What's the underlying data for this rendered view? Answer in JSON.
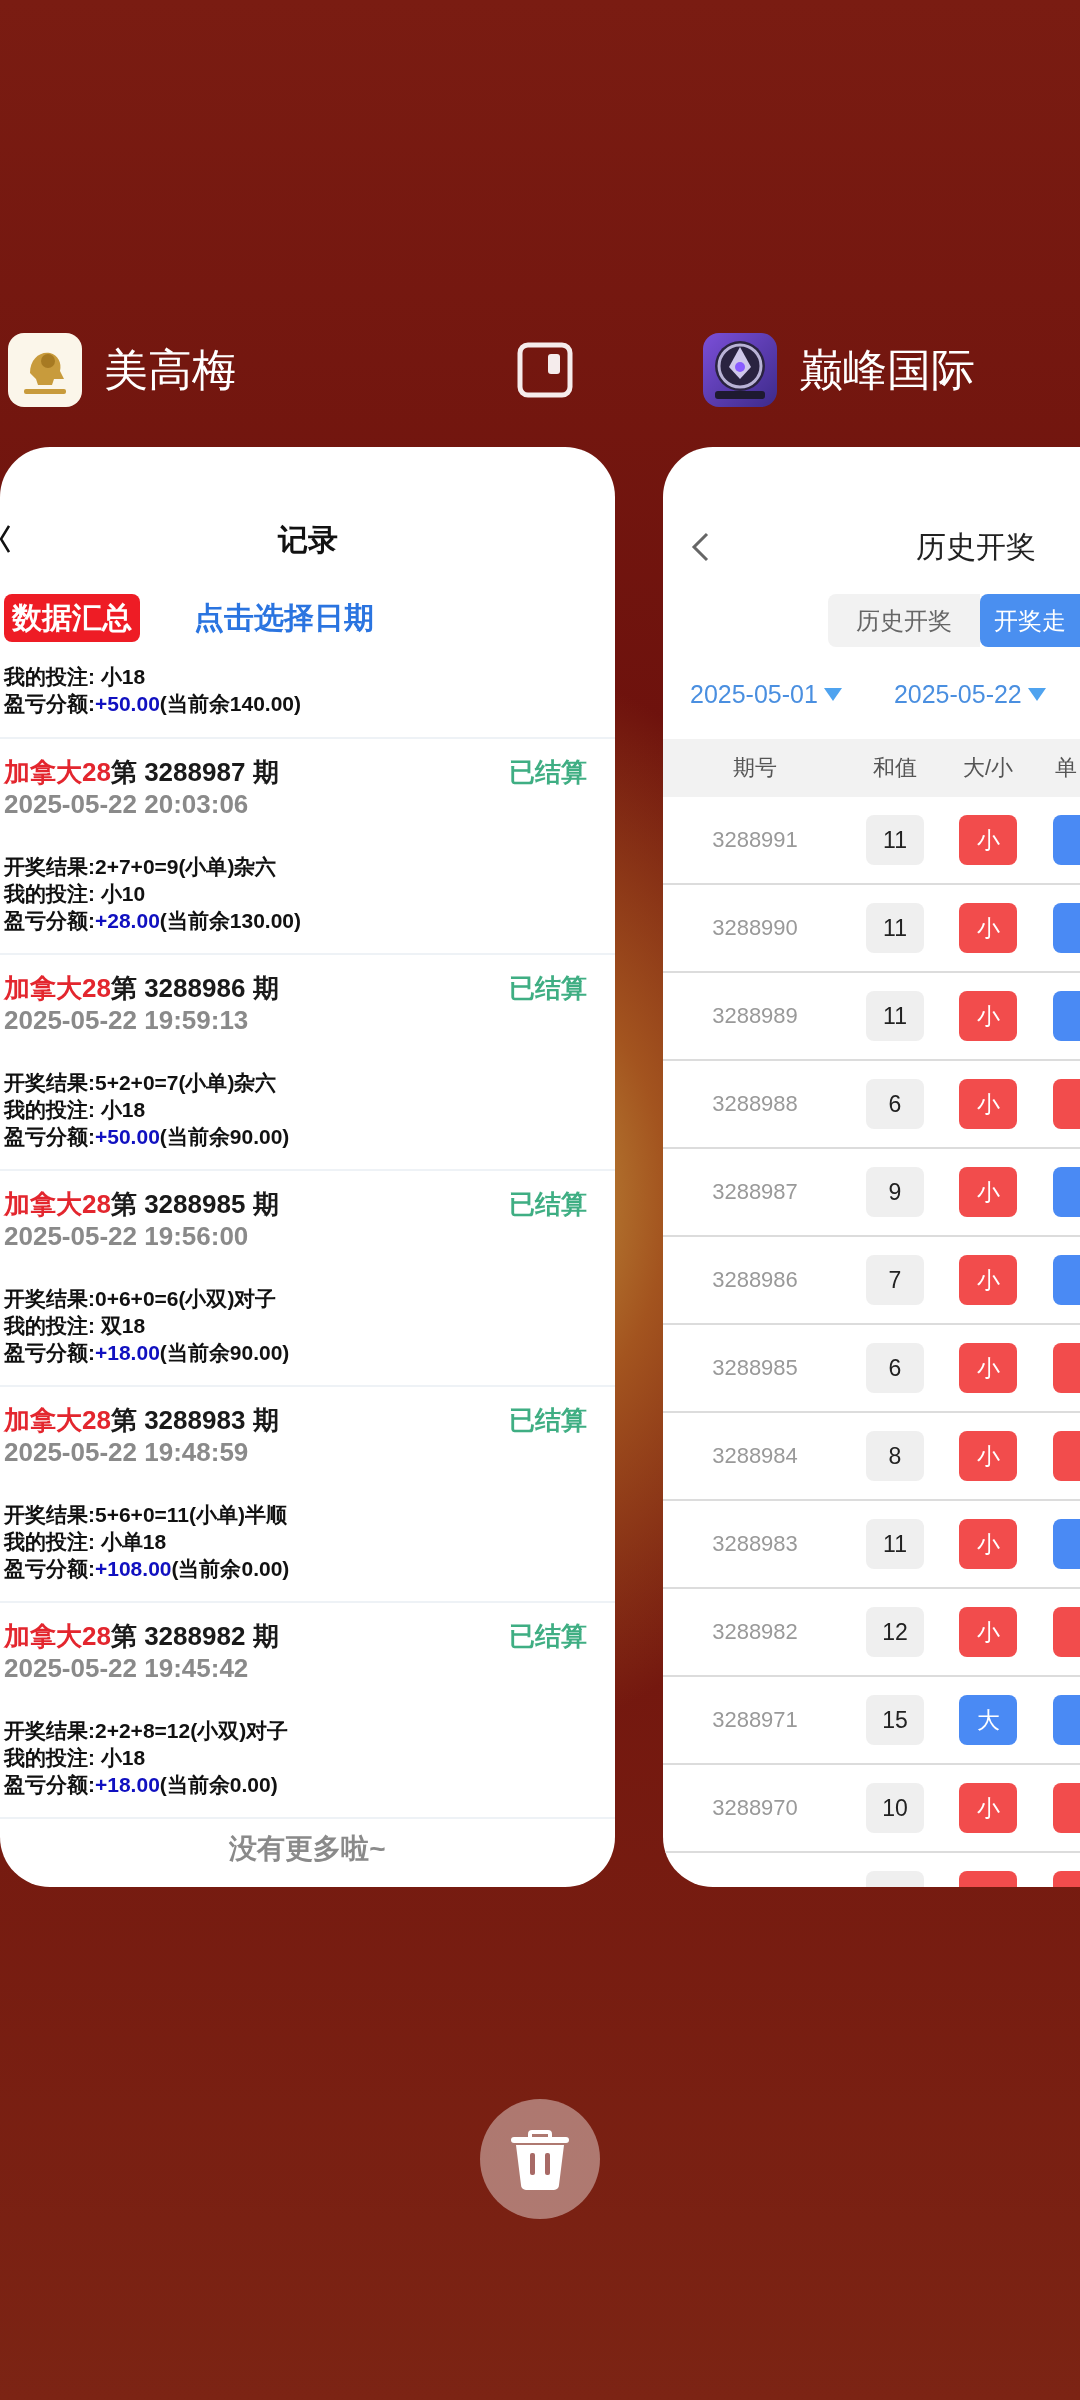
{
  "recent_apps": [
    {
      "kind": "records",
      "app_name": "美高梅",
      "split_screen_button": true,
      "nav_title": "记录",
      "summary_button": "数据汇总",
      "date_link": "点击选择日期",
      "records": [
        {
          "bet": "我的投注: 小18",
          "profit": {
            "label": "盈亏分额:",
            "amount": "+50.00",
            "balance": "(当前余140.00)"
          }
        },
        {
          "game": "加拿大28",
          "issue": "第 3288987 期",
          "status": "已结算",
          "time": "2025-05-22 20:03:06",
          "result": "开奖结果:2+7+0=9(小单)杂六",
          "bet": "我的投注: 小10",
          "profit": {
            "label": "盈亏分额:",
            "amount": "+28.00",
            "balance": "(当前余130.00)"
          }
        },
        {
          "game": "加拿大28",
          "issue": "第 3288986 期",
          "status": "已结算",
          "time": "2025-05-22 19:59:13",
          "result": "开奖结果:5+2+0=7(小单)杂六",
          "bet": "我的投注: 小18",
          "profit": {
            "label": "盈亏分额:",
            "amount": "+50.00",
            "balance": "(当前余90.00)"
          }
        },
        {
          "game": "加拿大28",
          "issue": "第 3288985 期",
          "status": "已结算",
          "time": "2025-05-22 19:56:00",
          "result": "开奖结果:0+6+0=6(小双)对子",
          "bet": "我的投注: 双18",
          "profit": {
            "label": "盈亏分额:",
            "amount": "+18.00",
            "balance": "(当前余90.00)"
          }
        },
        {
          "game": "加拿大28",
          "issue": "第 3288983 期",
          "status": "已结算",
          "time": "2025-05-22 19:48:59",
          "result": "开奖结果:5+6+0=11(小单)半顺",
          "bet": "我的投注: 小单18",
          "profit": {
            "label": "盈亏分额:",
            "amount": "+108.00",
            "balance": "(当前余0.00)"
          }
        },
        {
          "game": "加拿大28",
          "issue": "第 3288982 期",
          "status": "已结算",
          "time": "2025-05-22 19:45:42",
          "result": "开奖结果:2+2+8=12(小双)对子",
          "bet": "我的投注: 小18",
          "profit": {
            "label": "盈亏分额:",
            "amount": "+18.00",
            "balance": "(当前余0.00)"
          }
        }
      ],
      "footer": "没有更多啦~"
    },
    {
      "kind": "history",
      "app_name": "巅峰国际",
      "split_screen_button": false,
      "nav_title": "历史开奖",
      "segments": [
        {
          "label": "历史开奖",
          "selected": false
        },
        {
          "label": "开奖走",
          "selected": true
        }
      ],
      "date_filters": [
        "2025-05-01",
        "2025-05-22"
      ],
      "table": {
        "columns": [
          "期号",
          "和值",
          "大/小",
          "单"
        ],
        "rows": [
          {
            "issue": "3288991",
            "sum": "11",
            "size": {
              "label": "小",
              "color": "#f24c4c"
            },
            "parity": {
              "color": "#4a8af4"
            }
          },
          {
            "issue": "3288990",
            "sum": "11",
            "size": {
              "label": "小",
              "color": "#f24c4c"
            },
            "parity": {
              "color": "#4a8af4"
            }
          },
          {
            "issue": "3288989",
            "sum": "11",
            "size": {
              "label": "小",
              "color": "#f24c4c"
            },
            "parity": {
              "color": "#4a8af4"
            }
          },
          {
            "issue": "3288988",
            "sum": "6",
            "size": {
              "label": "小",
              "color": "#f24c4c"
            },
            "parity": {
              "color": "#f24c4c"
            }
          },
          {
            "issue": "3288987",
            "sum": "9",
            "size": {
              "label": "小",
              "color": "#f24c4c"
            },
            "parity": {
              "color": "#4a8af4"
            }
          },
          {
            "issue": "3288986",
            "sum": "7",
            "size": {
              "label": "小",
              "color": "#f24c4c"
            },
            "parity": {
              "color": "#4a8af4"
            }
          },
          {
            "issue": "3288985",
            "sum": "6",
            "size": {
              "label": "小",
              "color": "#f24c4c"
            },
            "parity": {
              "color": "#f24c4c"
            }
          },
          {
            "issue": "3288984",
            "sum": "8",
            "size": {
              "label": "小",
              "color": "#f24c4c"
            },
            "parity": {
              "color": "#f24c4c"
            }
          },
          {
            "issue": "3288983",
            "sum": "11",
            "size": {
              "label": "小",
              "color": "#f24c4c"
            },
            "parity": {
              "color": "#4a8af4"
            }
          },
          {
            "issue": "3288982",
            "sum": "12",
            "size": {
              "label": "小",
              "color": "#f24c4c"
            },
            "parity": {
              "color": "#f24c4c"
            }
          },
          {
            "issue": "3288971",
            "sum": "15",
            "size": {
              "label": "大",
              "color": "#4a8af4"
            },
            "parity": {
              "color": "#4a8af4"
            }
          },
          {
            "issue": "3288970",
            "sum": "10",
            "size": {
              "label": "小",
              "color": "#f24c4c"
            },
            "parity": {
              "color": "#f24c4c"
            }
          },
          {
            "size": {
              "color": "#f24c4c"
            },
            "parity": {
              "color": "#f24c4c"
            }
          }
        ]
      }
    }
  ]
}
